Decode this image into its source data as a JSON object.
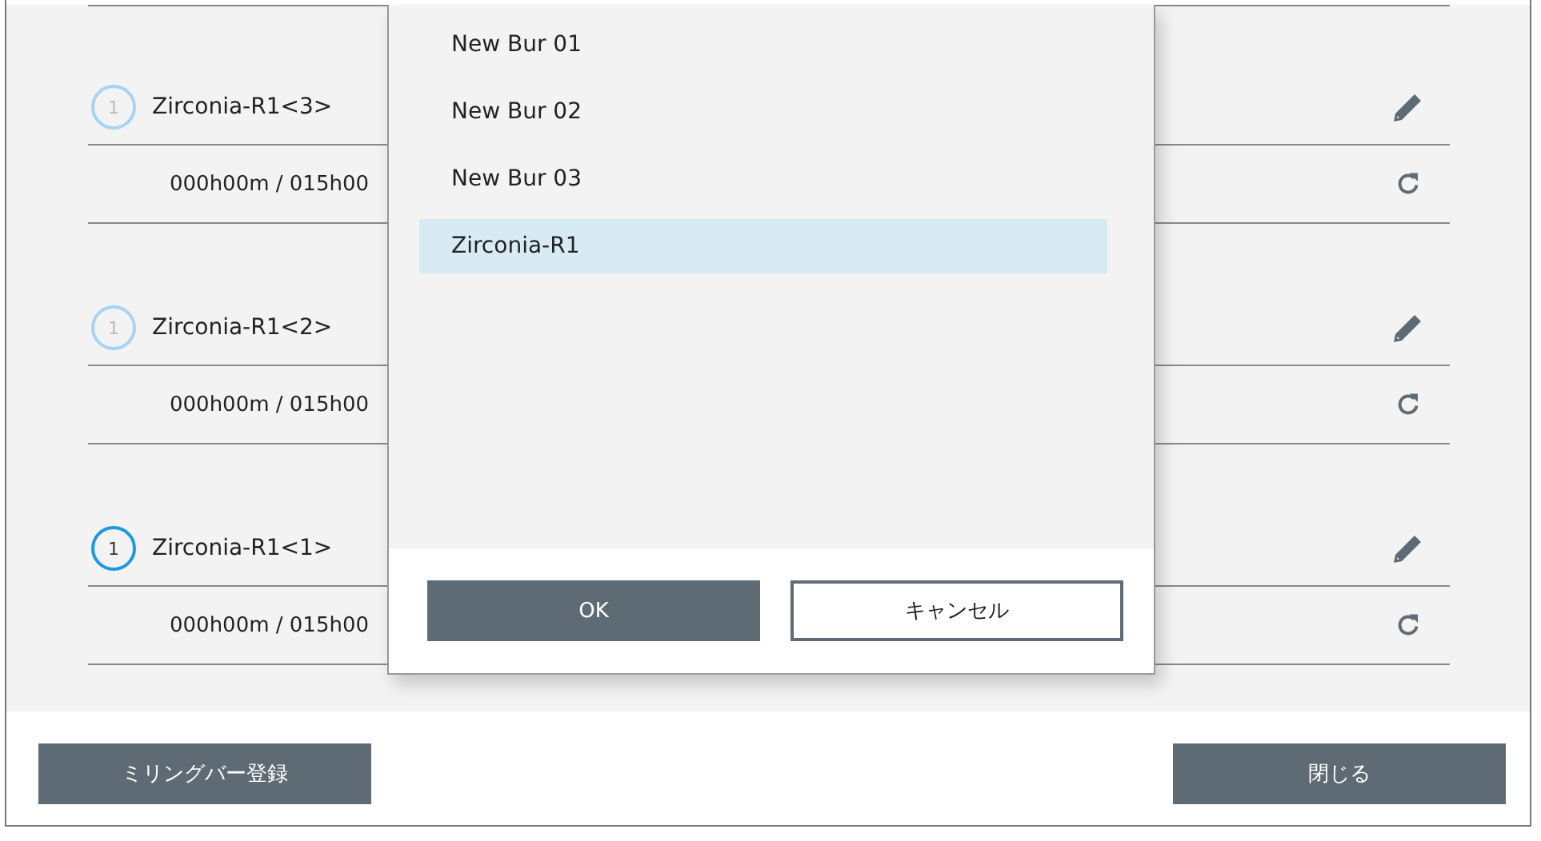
{
  "bur_slots": [
    {
      "number": "1",
      "active": false,
      "name": "Zirconia-R1<3>",
      "usage": "000h00m / 015h00"
    },
    {
      "number": "1",
      "active": false,
      "name": "Zirconia-R1<2>",
      "usage": "000h00m / 015h00"
    },
    {
      "number": "1",
      "active": true,
      "name": "Zirconia-R1<1>",
      "usage": "000h00m / 015h00"
    }
  ],
  "dialog": {
    "items": [
      {
        "label": "New Bur 01",
        "selected": false
      },
      {
        "label": "New Bur 02",
        "selected": false
      },
      {
        "label": "New Bur 03",
        "selected": false
      },
      {
        "label": "Zirconia-R1",
        "selected": true
      }
    ],
    "buttons": [
      {
        "label": "OK",
        "kind": "primary"
      },
      {
        "label": "キャンセル",
        "kind": "secondary"
      }
    ]
  },
  "footer_buttons": [
    "ミリングバー登録",
    "閉じる"
  ]
}
